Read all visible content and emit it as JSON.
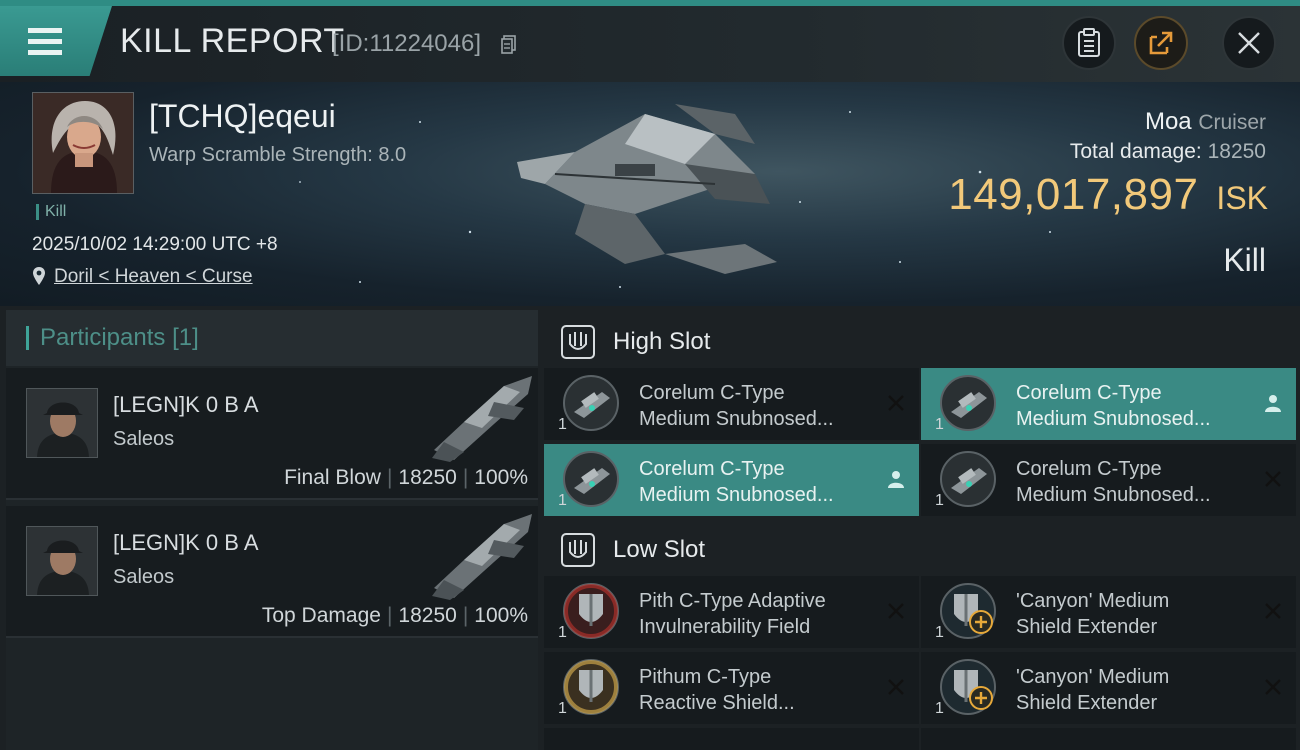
{
  "header": {
    "title": "KILL REPORT",
    "report_id": "[ID:11224046]"
  },
  "victim": {
    "name": "[TCHQ]eqeui",
    "warp_scramble": "Warp Scramble Strength: 8.0",
    "tag": "Kill",
    "timestamp": "2025/10/02 14:29:00 UTC +8",
    "location": "Doril < Heaven < Curse"
  },
  "ship": {
    "name": "Moa",
    "class": "Cruiser",
    "total_damage_label": "Total damage:",
    "total_damage_value": "18250",
    "isk_value": "149,017,897",
    "isk_unit": "ISK",
    "result": "Kill"
  },
  "participants": {
    "title": "Participants",
    "count": "[1]",
    "list": [
      {
        "name": "[LEGN]K 0 B A",
        "ship": "Saleos",
        "role": "Final Blow",
        "damage": "18250",
        "percent": "100%"
      },
      {
        "name": "[LEGN]K 0 B A",
        "ship": "Saleos",
        "role": "Top Damage",
        "damage": "18250",
        "percent": "100%"
      }
    ]
  },
  "slots": {
    "high": {
      "label": "High Slot",
      "items": [
        {
          "line1": "Corelum C-Type",
          "line2": "Medium Snubnosed...",
          "qty": "1",
          "status": "destroyed",
          "highlight": false
        },
        {
          "line1": "Corelum C-Type",
          "line2": "Medium Snubnosed...",
          "qty": "1",
          "status": "dropped",
          "highlight": true
        },
        {
          "line1": "Corelum C-Type",
          "line2": "Medium Snubnosed...",
          "qty": "1",
          "status": "dropped",
          "highlight": true
        },
        {
          "line1": "Corelum C-Type",
          "line2": "Medium Snubnosed...",
          "qty": "1",
          "status": "destroyed",
          "highlight": false
        }
      ]
    },
    "low": {
      "label": "Low Slot",
      "items": [
        {
          "line1": "Pith C-Type Adaptive",
          "line2": "Invulnerability Field",
          "qty": "1",
          "status": "destroyed",
          "highlight": false
        },
        {
          "line1": "'Canyon' Medium",
          "line2": "Shield Extender",
          "qty": "1",
          "status": "destroyed",
          "highlight": false
        },
        {
          "line1": "Pithum C-Type",
          "line2": "Reactive Shield...",
          "qty": "1",
          "status": "destroyed",
          "highlight": false
        },
        {
          "line1": "'Canyon' Medium",
          "line2": "Shield Extender",
          "qty": "1",
          "status": "destroyed",
          "highlight": false
        }
      ]
    }
  },
  "colors": {
    "accent": "#3a8a84",
    "isk": "#f2c97a",
    "panel": "#161b1e"
  },
  "icons": {
    "menu": "hamburger-icon",
    "copy": "copy-icon",
    "clipboard": "clipboard-icon",
    "share": "share-icon",
    "close": "close-icon",
    "location": "location-pin-icon",
    "slot": "slot-shield-icon",
    "destroyed": "x-icon",
    "dropped": "person-icon"
  }
}
